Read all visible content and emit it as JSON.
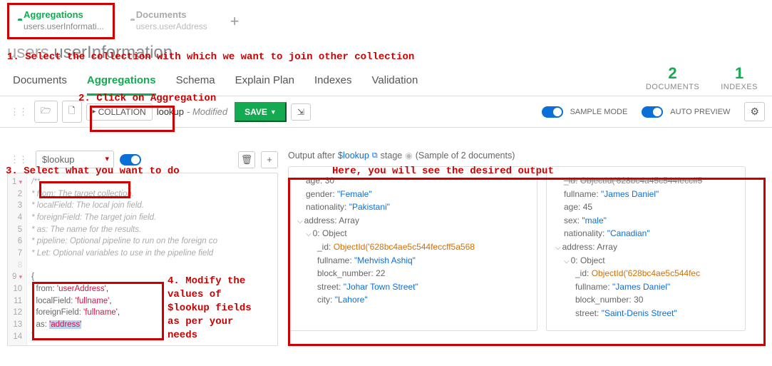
{
  "top_tabs": {
    "active": {
      "title": "Aggregations",
      "sub": "users.userInformati..."
    },
    "inactive": {
      "title": "Documents",
      "sub": "users.userAddress"
    },
    "plus": "+"
  },
  "annotations": {
    "a1": "1. Select the collection with which we want to join other collection",
    "a2": "2. Click on Aggregation",
    "a3": "3. Select what you want to do",
    "a4": "4. Modify the\nvalues of\n$lookup fields\nas per your\nneeds",
    "a5": "Here, you will see the desired output"
  },
  "ns": {
    "db": "users",
    "coll": "userInformation"
  },
  "stats": {
    "docs_n": "2",
    "docs_l": "DOCUMENTS",
    "idx_n": "1",
    "idx_l": "INDEXES"
  },
  "view_tabs": [
    "Documents",
    "Aggregations",
    "Schema",
    "Explain Plan",
    "Indexes",
    "Validation"
  ],
  "toolbar": {
    "collation": "COLLATION",
    "pipeline_name": "lookup",
    "modified": "- Modified",
    "save": "SAVE",
    "sample_mode": "SAMPLE MODE",
    "auto_preview": "AUTO PREVIEW"
  },
  "stage": {
    "operator": "$lookup",
    "code": {
      "l1": "/**",
      "l2": " * from: The target collection.",
      "l3": " * localField: The local join field.",
      "l4": " * foreignField: The target join field.",
      "l5": " * as: The name for the results.",
      "l6": " * pipeline: Optional pipeline to run on the foreign co",
      "l7": " * Let: Optional variables to use in the pipeline field",
      "l9": "{",
      "l10_k": "from:",
      "l10_v": "'userAddress'",
      "l11_k": "localField:",
      "l11_v": "'fullname'",
      "l12_k": "foreignField:",
      "l12_v": "'fullname'",
      "l13_k": "as:",
      "l13_v": "'address'",
      "l14": "}"
    }
  },
  "output": {
    "prefix": "Output after",
    "stage": "$lookup",
    "suffix": "stage",
    "sample": "(Sample of 2 documents)",
    "doc1": {
      "age_k": "age:",
      "age_v": "30",
      "gender_k": "gender:",
      "gender_v": "\"Female\"",
      "nat_k": "nationality:",
      "nat_v": "\"Pakistani\"",
      "addr_k": "address:",
      "addr_v": "Array",
      "obj_k": "0:",
      "obj_v": "Object",
      "id_k": "_id:",
      "id_v": "ObjectId('628bc4ae5c544feccff5a568",
      "fn_k": "fullname:",
      "fn_v": "\"Mehvish Ashiq\"",
      "bn_k": "block_number:",
      "bn_v": "22",
      "st_k": "street:",
      "st_v": "\"Johar Town Street\"",
      "ct_k": "city:",
      "ct_v": "\"Lahore\""
    },
    "doc2": {
      "id0_k": "_id:",
      "id0_v": "ObjectId('628bc4a45c544feccff5",
      "fn0_k": "fullname:",
      "fn0_v": "\"James Daniel\"",
      "age_k": "age:",
      "age_v": "45",
      "sex_k": "sex:",
      "sex_v": "\"male\"",
      "nat_k": "nationality:",
      "nat_v": "\"Canadian\"",
      "addr_k": "address:",
      "addr_v": "Array",
      "obj_k": "0:",
      "obj_v": "Object",
      "id_k": "_id:",
      "id_v": "ObjectId('628bc4ae5c544fec",
      "fn_k": "fullname:",
      "fn_v": "\"James Daniel\"",
      "bn_k": "block_number:",
      "bn_v": "30",
      "st_k": "street:",
      "st_v": "\"Saint-Denis Street\""
    }
  }
}
